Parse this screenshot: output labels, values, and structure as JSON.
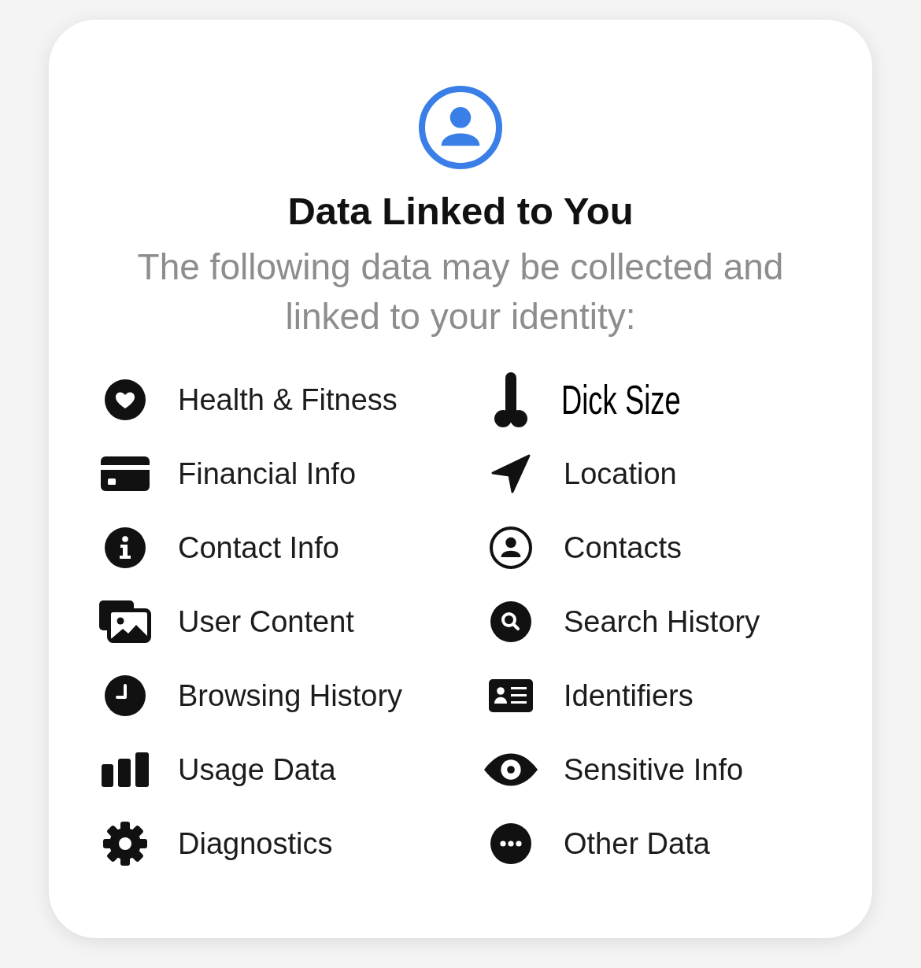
{
  "header": {
    "title": "Data Linked to You",
    "description": "The following data may be collected and linked to your identity:"
  },
  "columns": [
    {
      "items": [
        {
          "kind": "standard",
          "label": "Health & Fitness"
        },
        {
          "kind": "standard",
          "label": "Financial Info"
        },
        {
          "kind": "standard",
          "label": "Contact Info"
        },
        {
          "kind": "standard",
          "label": "User Content"
        },
        {
          "kind": "standard",
          "label": "Browsing History"
        },
        {
          "kind": "standard",
          "label": "Usage Data"
        },
        {
          "kind": "standard",
          "label": "Diagnostics"
        }
      ]
    },
    {
      "items": [
        {
          "kind": "condensed",
          "label": "Dick Size"
        },
        {
          "kind": "standard",
          "label": "Location"
        },
        {
          "kind": "standard",
          "label": "Contacts"
        },
        {
          "kind": "standard",
          "label": "Search History"
        },
        {
          "kind": "standard",
          "label": "Identifiers"
        },
        {
          "kind": "standard",
          "label": "Sensitive Info"
        },
        {
          "kind": "standard",
          "label": "Other Data"
        }
      ]
    }
  ]
}
